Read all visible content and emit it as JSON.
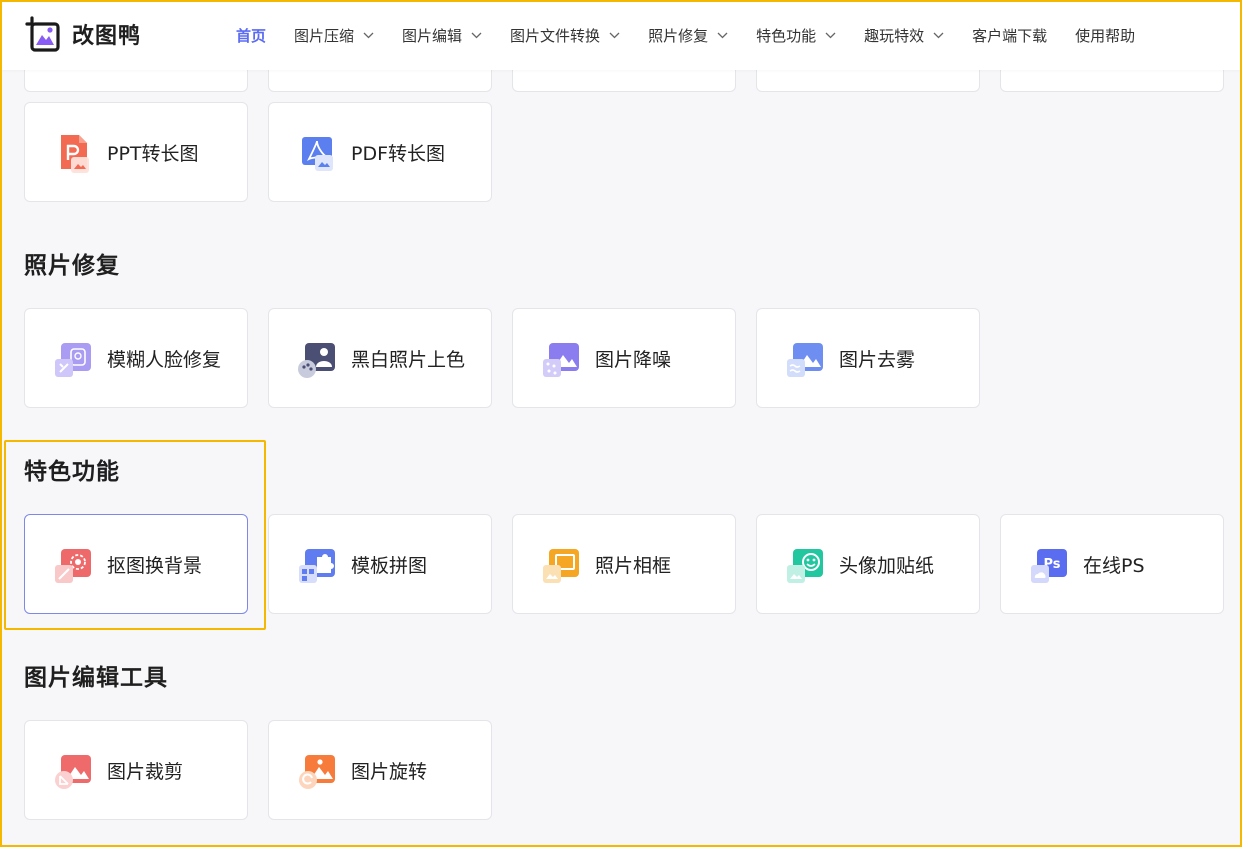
{
  "app": {
    "name": "改图鸭"
  },
  "nav": {
    "items": [
      {
        "label": "首页",
        "active": true,
        "has_dropdown": false
      },
      {
        "label": "图片压缩",
        "active": false,
        "has_dropdown": true
      },
      {
        "label": "图片编辑",
        "active": false,
        "has_dropdown": true
      },
      {
        "label": "图片文件转换",
        "active": false,
        "has_dropdown": true
      },
      {
        "label": "照片修复",
        "active": false,
        "has_dropdown": true
      },
      {
        "label": "特色功能",
        "active": false,
        "has_dropdown": true
      },
      {
        "label": "趣玩特效",
        "active": false,
        "has_dropdown": true
      },
      {
        "label": "客户端下载",
        "active": false,
        "has_dropdown": false
      },
      {
        "label": "使用帮助",
        "active": false,
        "has_dropdown": false
      }
    ]
  },
  "sections": {
    "convert": {
      "items": [
        {
          "label": "PPT转长图",
          "icon": "ppt-to-image-icon"
        },
        {
          "label": "PDF转长图",
          "icon": "pdf-to-image-icon"
        }
      ]
    },
    "repair": {
      "title": "照片修复",
      "items": [
        {
          "label": "模糊人脸修复",
          "icon": "face-repair-icon"
        },
        {
          "label": "黑白照片上色",
          "icon": "colorize-icon"
        },
        {
          "label": "图片降噪",
          "icon": "denoise-icon"
        },
        {
          "label": "图片去雾",
          "icon": "dehaze-icon"
        }
      ]
    },
    "featured": {
      "title": "特色功能",
      "items": [
        {
          "label": "抠图换背景",
          "icon": "cutout-icon",
          "selected": true
        },
        {
          "label": "模板拼图",
          "icon": "puzzle-icon"
        },
        {
          "label": "照片相框",
          "icon": "photo-frame-icon"
        },
        {
          "label": "头像加贴纸",
          "icon": "sticker-icon"
        },
        {
          "label": "在线PS",
          "icon": "online-ps-icon"
        }
      ]
    },
    "edit": {
      "title": "图片编辑工具",
      "items": [
        {
          "label": "图片裁剪",
          "icon": "crop-icon"
        },
        {
          "label": "图片旋转",
          "icon": "rotate-icon"
        }
      ]
    }
  },
  "colors": {
    "accent": "#5b6cf3",
    "highlight": "#f5b800",
    "background": "#f7f7fa"
  }
}
